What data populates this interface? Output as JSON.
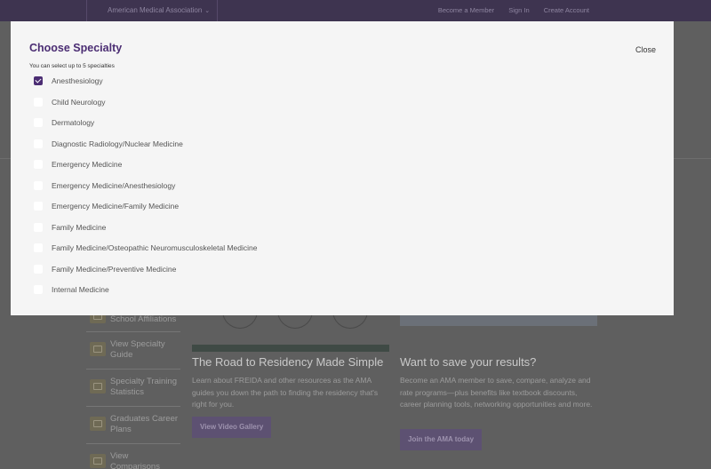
{
  "topbar": {
    "org_label": "American Medical Association",
    "links": [
      "Become a Member",
      "Sign In",
      "Create Account"
    ]
  },
  "side_nav": [
    {
      "label": "School Affiliations"
    },
    {
      "label": "View Specialty Guide"
    },
    {
      "label": "Specialty Training Statistics"
    },
    {
      "label": "Graduates Career Plans"
    },
    {
      "label": "View Comparisons"
    }
  ],
  "cards": [
    {
      "title": "The Road to Residency Made Simple",
      "text": "Learn about FREIDA and other resources as the AMA guides you down the path to finding the residency that's right for you.",
      "button": "View Video Gallery"
    },
    {
      "title": "Want to save your results?",
      "text": "Become an AMA member to save, compare, analyze and rate programs—plus benefits like textbook discounts, career planning tools, networking opportunities and more.",
      "button": "Join the AMA today"
    }
  ],
  "modal": {
    "title": "Choose Specialty",
    "subtitle": "You can select up to 5 specialties",
    "close_label": "Close",
    "specialties": [
      {
        "label": "Anesthesiology",
        "checked": true
      },
      {
        "label": "Child Neurology",
        "checked": false
      },
      {
        "label": "Dermatology",
        "checked": false
      },
      {
        "label": "Diagnostic Radiology/Nuclear Medicine",
        "checked": false
      },
      {
        "label": "Emergency Medicine",
        "checked": false
      },
      {
        "label": "Emergency Medicine/Anesthesiology",
        "checked": false
      },
      {
        "label": "Emergency Medicine/Family Medicine",
        "checked": false
      },
      {
        "label": "Family Medicine",
        "checked": false
      },
      {
        "label": "Family Medicine/Osteopathic Neuromusculoskeletal Medicine",
        "checked": false
      },
      {
        "label": "Family Medicine/Preventive Medicine",
        "checked": false
      },
      {
        "label": "Internal Medicine",
        "checked": false
      }
    ]
  },
  "colors": {
    "brand": "#4b2d73",
    "topbar": "#3e3450",
    "overlay": "#5f5f5f"
  }
}
